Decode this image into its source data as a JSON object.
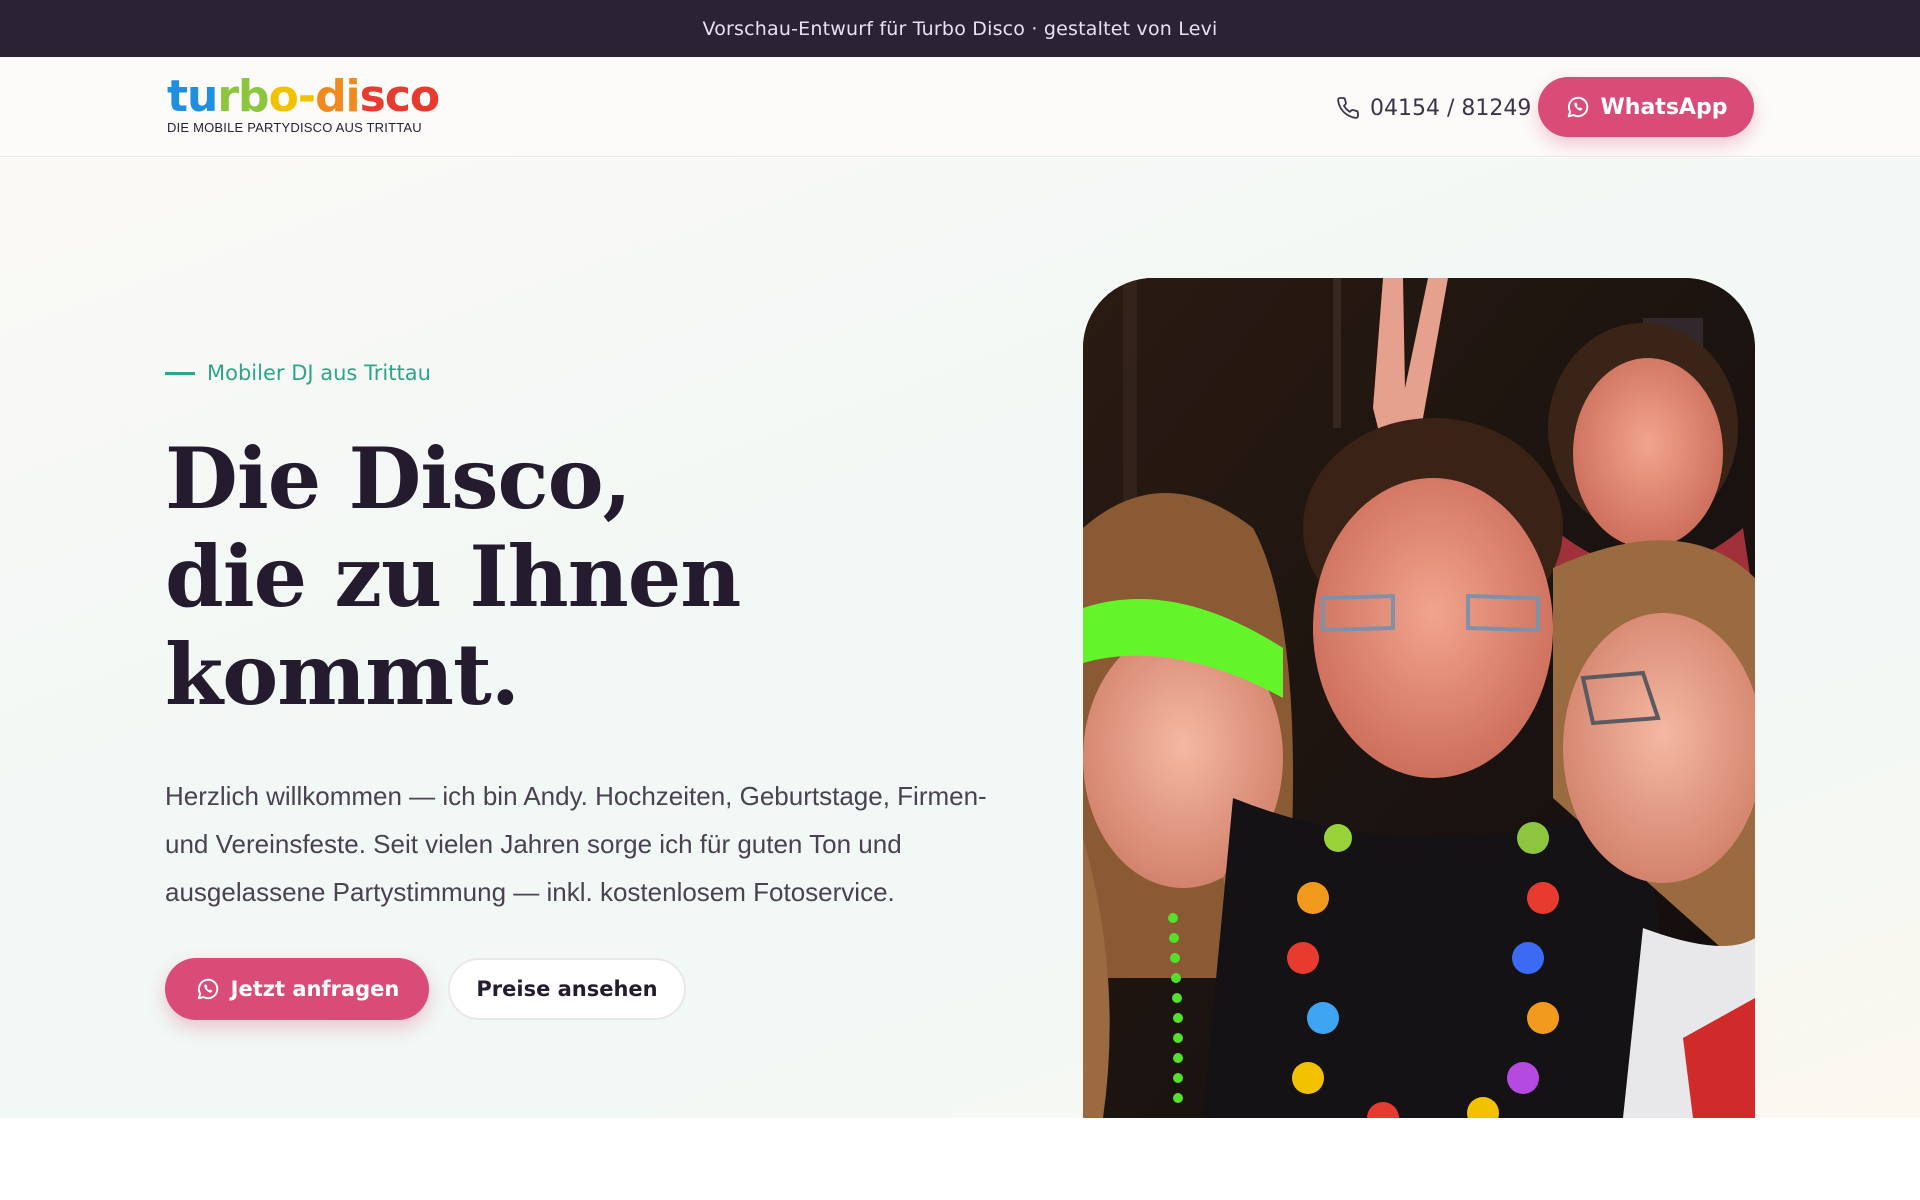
{
  "topbar": {
    "text": "Vorschau-Entwurf für Turbo Disco · gestaltet von Levi"
  },
  "header": {
    "logo": {
      "word_parts": [
        "tu",
        "rb",
        "o-",
        "di",
        "sco"
      ],
      "tagline": "DIE MOBILE PARTYDISCO AUS TRITTAU"
    },
    "phone": {
      "icon": "phone-icon",
      "number": "04154 / 81249"
    },
    "whatsapp_button": {
      "icon": "whatsapp-icon",
      "label": "WhatsApp"
    }
  },
  "hero": {
    "eyebrow": "Mobiler DJ aus Trittau",
    "headline_lines": [
      "Die Disco,",
      "die zu Ihnen",
      "kommt."
    ],
    "intro": "Herzlich willkommen — ich bin Andy. Hochzeiten, Geburtstage, Firmen- und Vereinsfeste. Seit vielen Jahren sorge ich für guten Ton und ausgelassene Partystimmung — inkl. kostenlosem Fotoservice.",
    "cta_primary": {
      "icon": "whatsapp-icon",
      "label": "Jetzt anfragen"
    },
    "cta_secondary": {
      "label": "Preise ansehen"
    }
  },
  "colors": {
    "accent_pink": "#d94c77",
    "accent_teal": "#2ea58a",
    "dark": "#241c2e",
    "topbar_bg": "#2b2236"
  }
}
